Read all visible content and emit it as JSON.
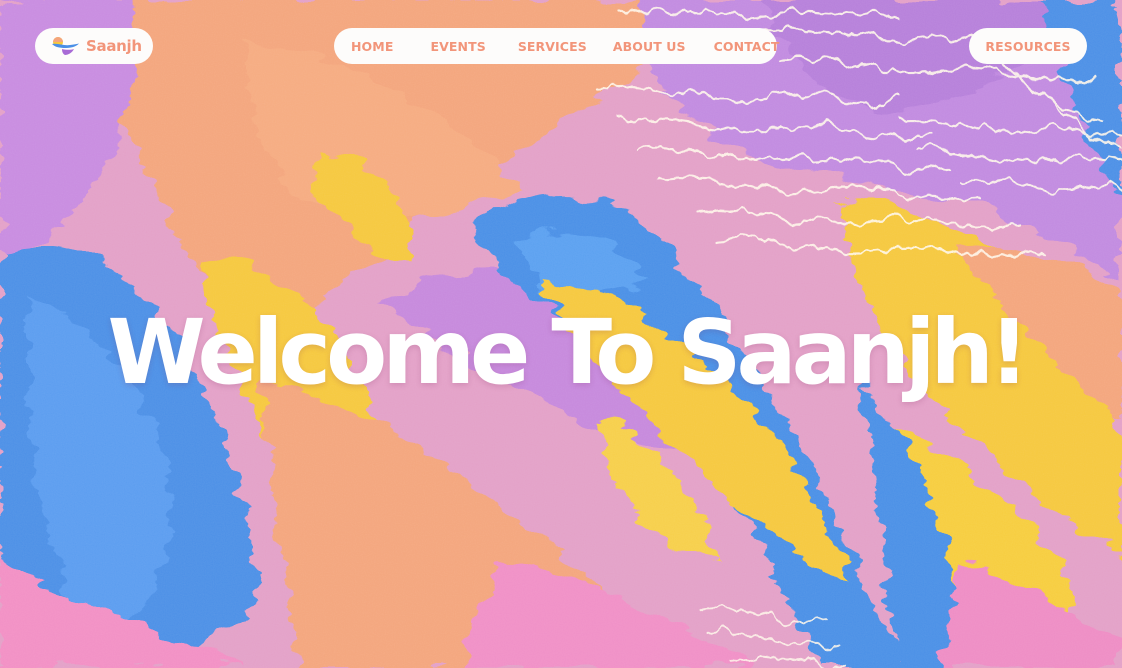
{
  "brand": {
    "name": "Saanjh",
    "text_color": "#f2957a"
  },
  "nav": {
    "items": [
      {
        "label": "HOME"
      },
      {
        "label": "EVENTS"
      },
      {
        "label": "SERVICES"
      },
      {
        "label": "ABOUT US"
      },
      {
        "label": "CONTACT"
      }
    ]
  },
  "resources": {
    "label": "RESOURCES"
  },
  "hero": {
    "title": "Welcome To Saanjh!",
    "background": "abstract-paint-swirl"
  },
  "colors": {
    "accent": "#f2957a",
    "pill_bg": "#fdfcfb",
    "paint_pink": "#e49fc8",
    "paint_orange": "#f4a57c",
    "paint_yellow": "#f6c83c",
    "paint_blue": "#4a8fe6",
    "paint_purple": "#c688dc"
  }
}
